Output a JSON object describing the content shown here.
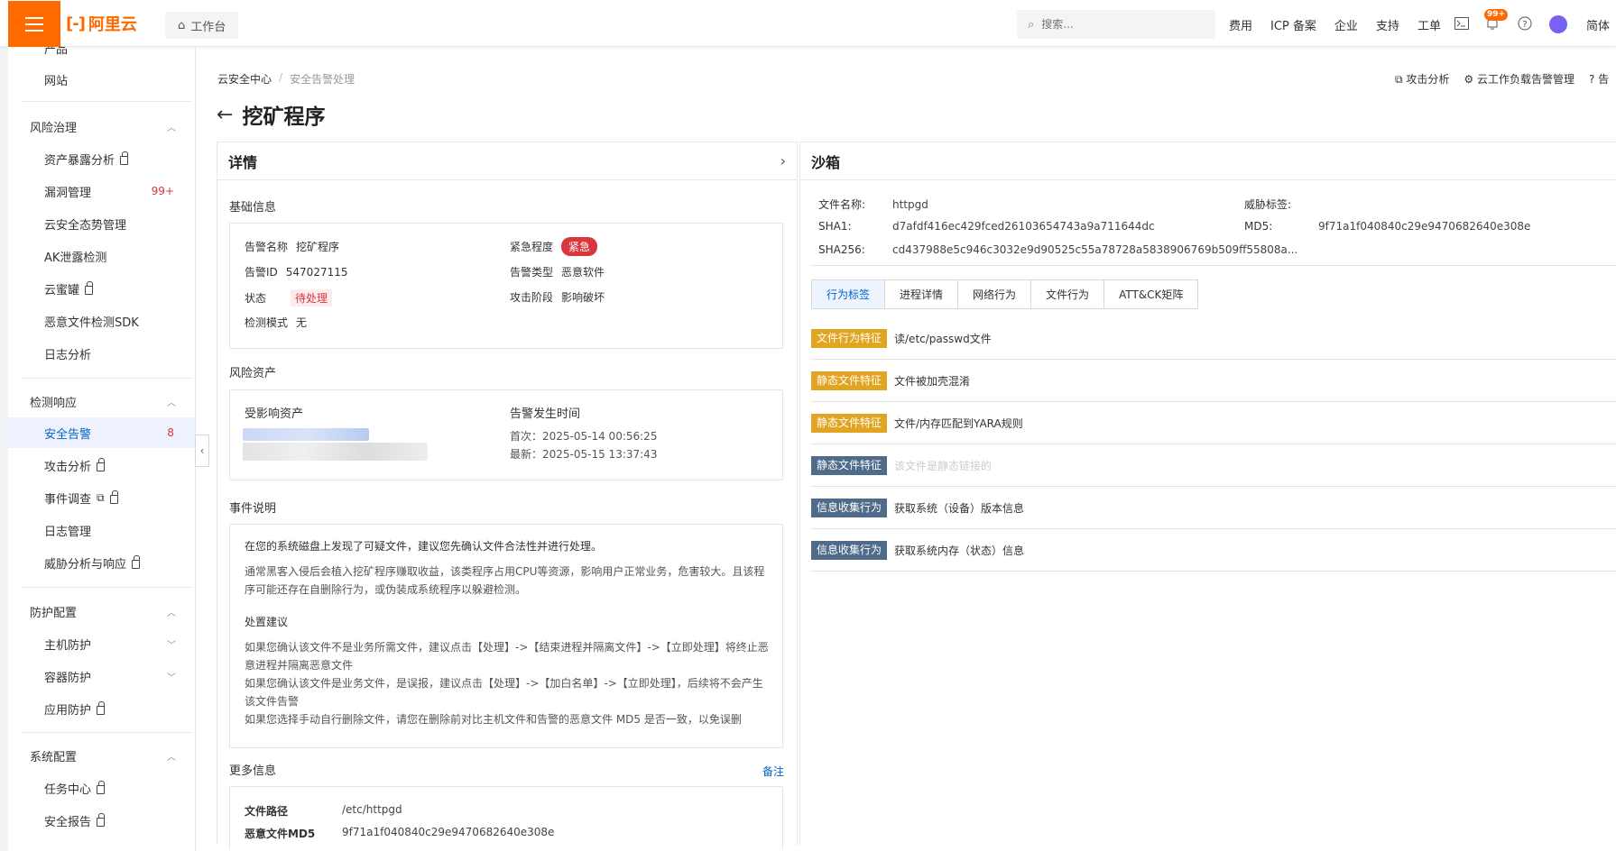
{
  "topbar": {
    "logo": "阿里云",
    "workbench": "工作台",
    "search_placeholder": "搜索...",
    "links": [
      "费用",
      "ICP 备案",
      "企业",
      "支持",
      "工单"
    ],
    "notification_count": "99+",
    "lang": "简体"
  },
  "sidebar": {
    "cut_item": "产品",
    "items_top": [
      {
        "label": "网站"
      }
    ],
    "groups": [
      {
        "label": "风险治理",
        "items": [
          {
            "label": "资产暴露分析",
            "lock": true
          },
          {
            "label": "漏洞管理",
            "count": "99+"
          },
          {
            "label": "云安全态势管理"
          },
          {
            "label": "AK泄露检测"
          },
          {
            "label": "云蜜罐",
            "lock": true
          },
          {
            "label": "恶意文件检测SDK"
          },
          {
            "label": "日志分析"
          }
        ]
      },
      {
        "label": "检测响应",
        "items": [
          {
            "label": "安全告警",
            "count": "8",
            "active": true
          },
          {
            "label": "攻击分析",
            "lock": true
          },
          {
            "label": "事件调查",
            "lock": true,
            "ext": true
          },
          {
            "label": "日志管理"
          },
          {
            "label": "威胁分析与响应",
            "lock": true
          }
        ]
      },
      {
        "label": "防护配置",
        "items": [
          {
            "label": "主机防护",
            "expand": true
          },
          {
            "label": "容器防护",
            "expand": true
          },
          {
            "label": "应用防护",
            "lock": true
          }
        ]
      },
      {
        "label": "系统配置",
        "items": [
          {
            "label": "任务中心",
            "lock": true
          },
          {
            "label": "安全报告",
            "lock": true
          }
        ]
      }
    ]
  },
  "breadcrumb": {
    "root": "云安全中心",
    "sep": "/",
    "current": "安全告警处理"
  },
  "top_actions": {
    "attack": "攻击分析",
    "workload": "云工作负载告警管理",
    "help": "告"
  },
  "page": {
    "title": "挖矿程序"
  },
  "details": {
    "header": "详情",
    "basic_title": "基础信息",
    "basic": {
      "alert_name_k": "告警名称",
      "alert_name_v": "挖矿程序",
      "urgency_k": "紧急程度",
      "urgency_v": "紧急",
      "alert_id_k": "告警ID",
      "alert_id_v": "547027115",
      "alert_type_k": "告警类型",
      "alert_type_v": "恶意软件",
      "status_k": "状态",
      "status_v": "待处理",
      "stage_k": "攻击阶段",
      "stage_v": "影响破坏",
      "mode_k": "检测模式",
      "mode_v": "无"
    },
    "asset_title": "风险资产",
    "asset": {
      "affected_k": "受影响资产",
      "time_k": "告警发生时间",
      "first": "首次：2025-05-14 00:56:25",
      "latest": "最新：2025-05-15 13:37:43"
    },
    "event_title": "事件说明",
    "event": {
      "headline": "在您的系统磁盘上发现了可疑文件，建议您先确认文件合法性并进行处理。",
      "desc_1": "通常黑客入侵后会植入挖矿程序赚取收益，该类程序占用CPU等资源，影响用户正常业务，危害较大。且该程",
      "desc_2": "序可能还存在自删除行为，或伪装成系统程序以躲避检测。",
      "advice_title": "处置建议",
      "advice_1": "如果您确认该文件不是业务所需文件，建议点击【处理】->【结束进程并隔离文件】->【立即处理】将终止恶",
      "advice_2": "意进程并隔离恶意文件",
      "advice_3": "如果您确认该文件是业务文件，是误报，建议点击【处理】->【加白名单】->【立即处理】，后续将不会产生",
      "advice_4": "该文件告警",
      "advice_5": "如果您选择手动自行删除文件，请您在删除前对比主机文件和告警的恶意文件 MD5 是否一致，以免误删"
    },
    "more_title": "更多信息",
    "note": "备注",
    "more": {
      "path_k": "文件路径",
      "path_v": "/etc/httpgd",
      "md5_k": "恶意文件MD5",
      "md5_v": "9f71a1f040840c29e9470682640e308e"
    }
  },
  "sandbox": {
    "header": "沙箱",
    "file_name_k": "文件名称:",
    "file_name_v": "httpgd",
    "threat_tag_k": "威胁标签:",
    "sha1_k": "SHA1:",
    "sha1_v": "d7afdf416ec429fced26103654743a9a711644dc",
    "md5_k": "MD5:",
    "md5_v": "9f71a1f040840c29e9470682640e308e",
    "sha256_k": "SHA256:",
    "sha256_v": "cd437988e5c946c3032e9d90525c55a78728a5838906769b509ff55808a...",
    "tabs": [
      "行为标签",
      "进程详情",
      "网络行为",
      "文件行为",
      "ATT&CK矩阵"
    ],
    "behaviors": [
      {
        "tag": "文件行为特征",
        "desc": "读/etc/passwd文件",
        "color": "#e2a521"
      },
      {
        "tag": "静态文件特征",
        "desc": "文件被加壳混淆",
        "color": "#e2a521"
      },
      {
        "tag": "静态文件特征",
        "desc": "文件/内存匹配到YARA规则",
        "color": "#e2a521"
      },
      {
        "tag": "静态文件特征",
        "desc": "该文件是静态链接的",
        "color": "#4f6b8a"
      },
      {
        "tag": "信息收集行为",
        "desc": "获取系统（设备）版本信息",
        "color": "#4f6b8a"
      },
      {
        "tag": "信息收集行为",
        "desc": "获取系统内存（状态）信息",
        "color": "#4f6b8a"
      }
    ]
  }
}
